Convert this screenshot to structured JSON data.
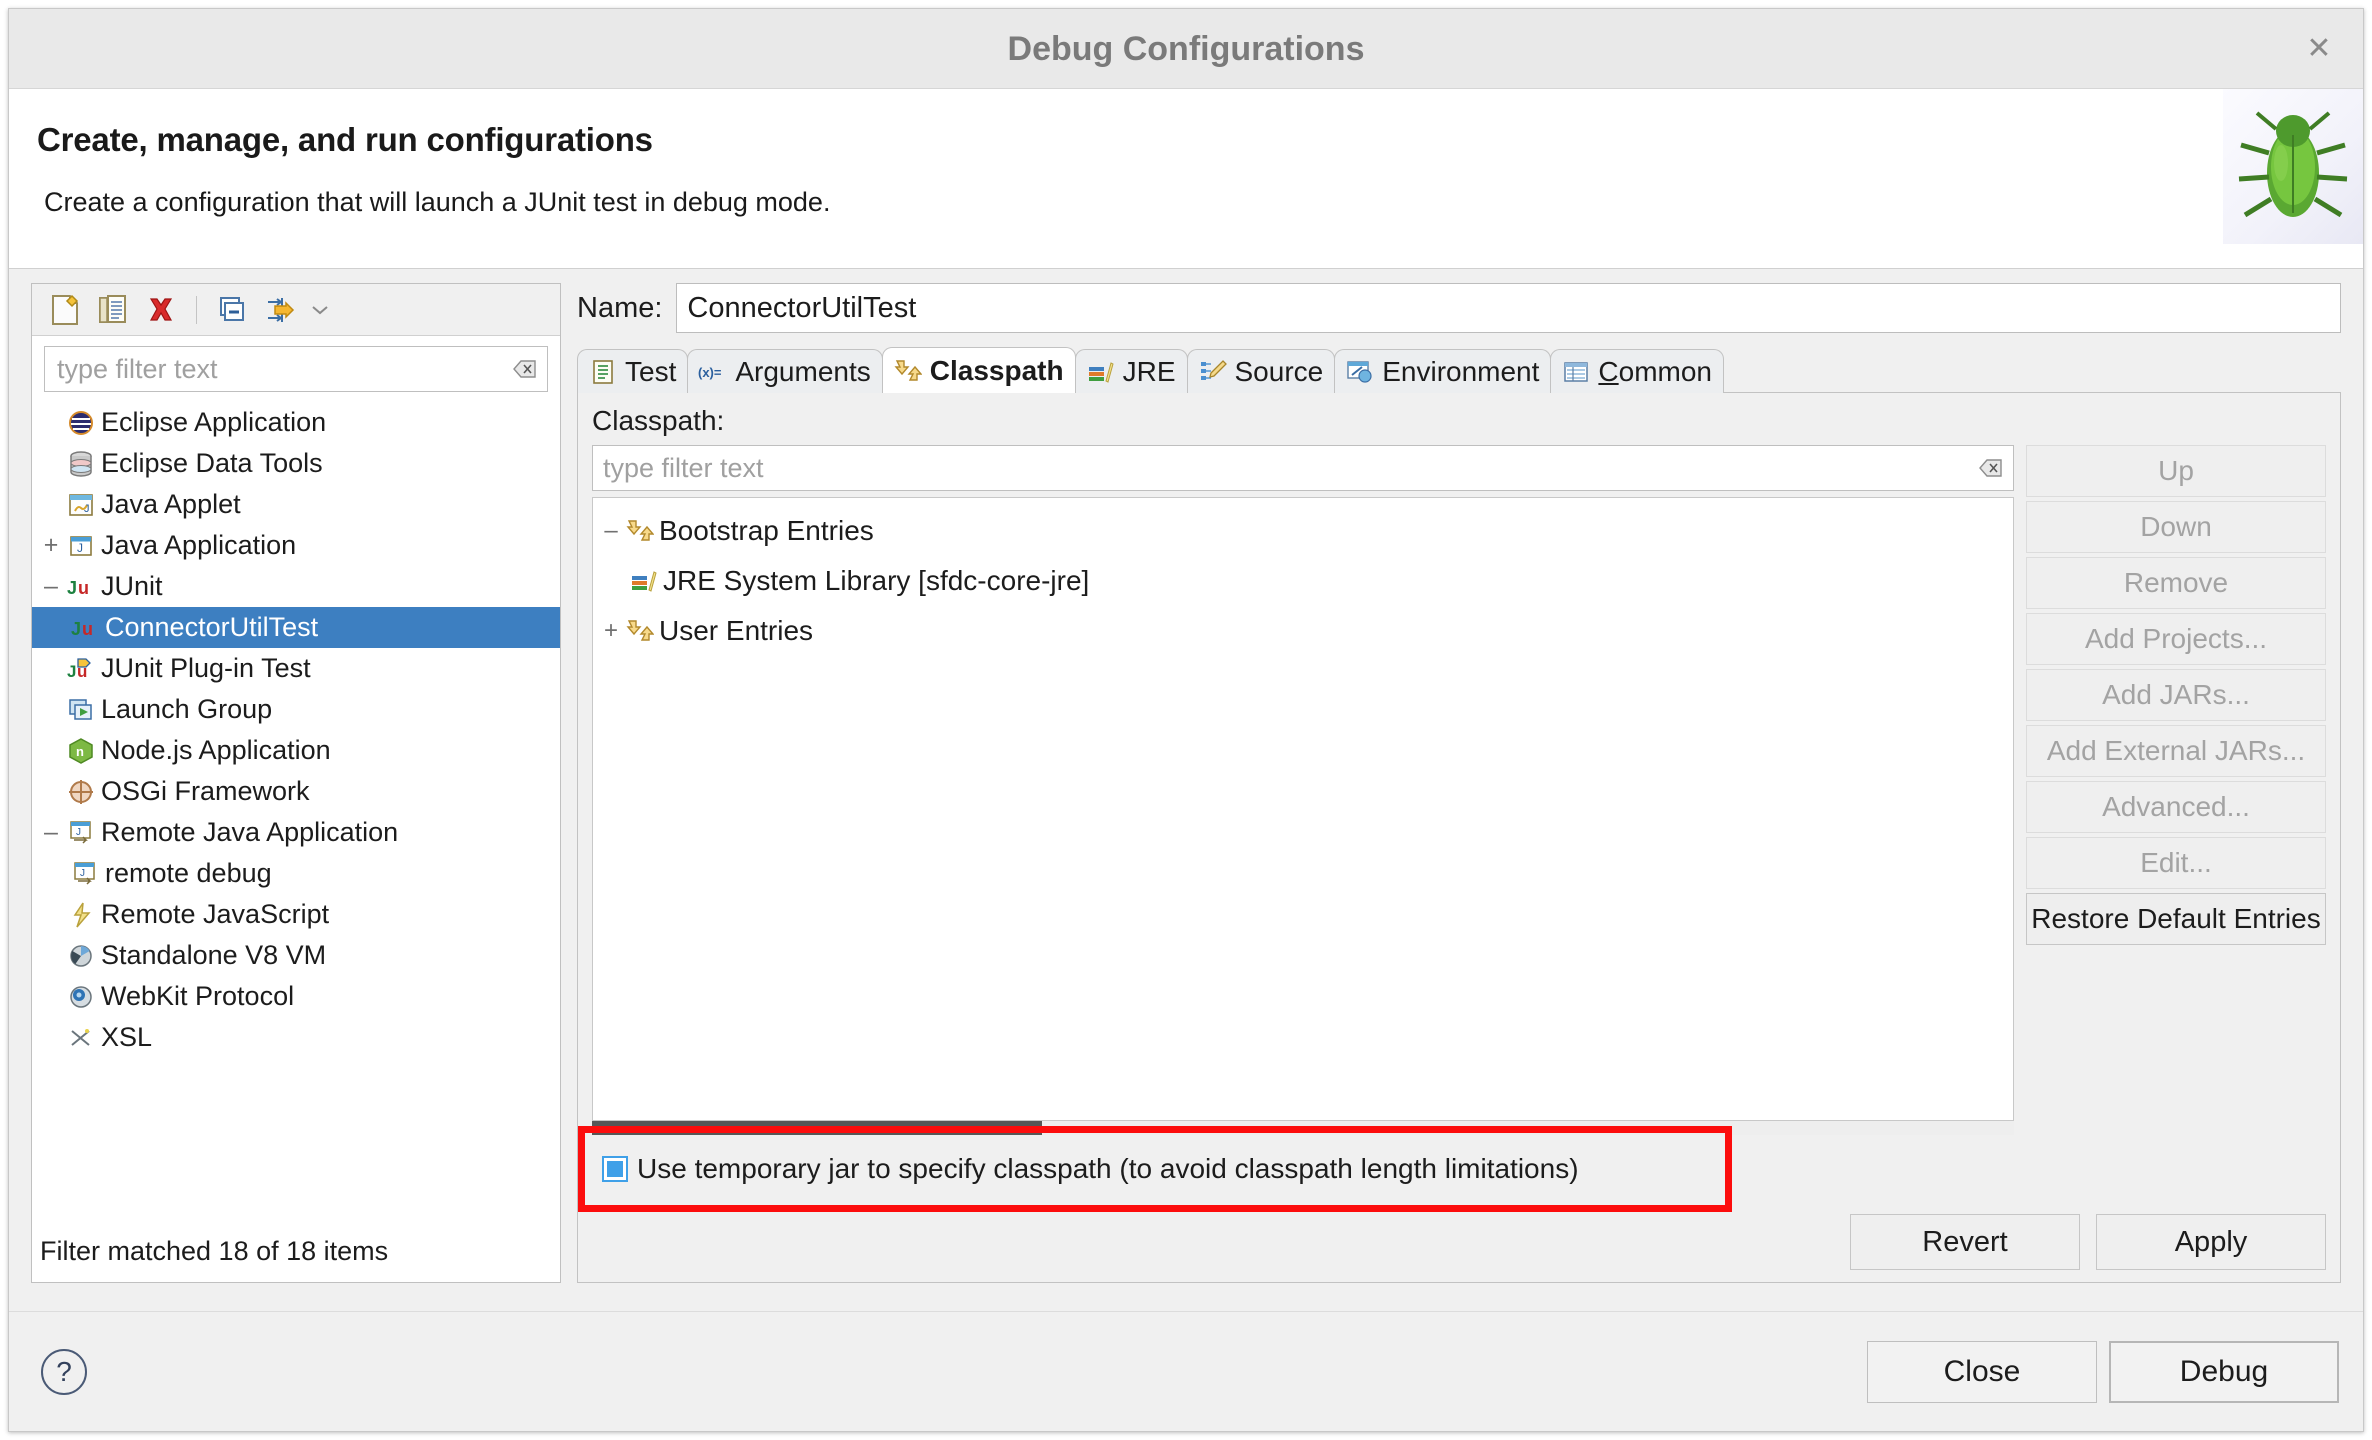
{
  "window": {
    "title": "Debug Configurations",
    "close_label": "✕"
  },
  "header": {
    "title": "Create, manage, and run configurations",
    "subtitle": "Create a configuration that will launch a JUnit test in debug mode.",
    "image": "bug-image"
  },
  "left_panel": {
    "toolbar": [
      {
        "name": "new-configuration-icon",
        "tooltip": "New launch configuration"
      },
      {
        "name": "duplicate-configuration-icon",
        "tooltip": "Duplicate"
      },
      {
        "name": "delete-configuration-icon",
        "tooltip": "Delete"
      },
      {
        "name": "collapse-all-icon",
        "tooltip": "Collapse All"
      },
      {
        "name": "filter-icon",
        "tooltip": "Filter launch configurations"
      },
      {
        "name": "chevron-down-icon",
        "tooltip": "View Menu"
      }
    ],
    "filter": {
      "placeholder": "type filter text",
      "value": ""
    },
    "tree": [
      {
        "label": "Eclipse Application",
        "icon": "eclipse-icon",
        "expander": "",
        "indent": 0,
        "selected": false
      },
      {
        "label": "Eclipse Data Tools",
        "icon": "database-icon",
        "expander": "",
        "indent": 0,
        "selected": false
      },
      {
        "label": "Java Applet",
        "icon": "java-applet-icon",
        "expander": "",
        "indent": 0,
        "selected": false
      },
      {
        "label": "Java Application",
        "icon": "java-application-icon",
        "expander": "+",
        "indent": 0,
        "selected": false
      },
      {
        "label": "JUnit",
        "icon": "junit-icon",
        "expander": "–",
        "indent": 0,
        "selected": false
      },
      {
        "label": "ConnectorUtilTest",
        "icon": "junit-icon",
        "expander": "",
        "indent": 1,
        "selected": true
      },
      {
        "label": "JUnit Plug-in Test",
        "icon": "junit-plugin-icon",
        "expander": "",
        "indent": 0,
        "selected": false
      },
      {
        "label": "Launch Group",
        "icon": "launch-group-icon",
        "expander": "",
        "indent": 0,
        "selected": false
      },
      {
        "label": "Node.js Application",
        "icon": "nodejs-icon",
        "expander": "",
        "indent": 0,
        "selected": false
      },
      {
        "label": "OSGi Framework",
        "icon": "osgi-icon",
        "expander": "",
        "indent": 0,
        "selected": false
      },
      {
        "label": "Remote Java Application",
        "icon": "remote-java-icon",
        "expander": "–",
        "indent": 0,
        "selected": false
      },
      {
        "label": "remote debug",
        "icon": "remote-java-icon",
        "expander": "",
        "indent": 1,
        "selected": false
      },
      {
        "label": "Remote JavaScript",
        "icon": "remote-javascript-icon",
        "expander": "",
        "indent": 0,
        "selected": false
      },
      {
        "label": "Standalone V8 VM",
        "icon": "v8-icon",
        "expander": "",
        "indent": 0,
        "selected": false
      },
      {
        "label": "WebKit Protocol",
        "icon": "webkit-icon",
        "expander": "",
        "indent": 0,
        "selected": false
      },
      {
        "label": "XSL",
        "icon": "xsl-icon",
        "expander": "",
        "indent": 0,
        "selected": false
      }
    ],
    "status": "Filter matched 18 of 18 items"
  },
  "right_panel": {
    "name_label": "Name:",
    "name_value": "ConnectorUtilTest",
    "tabs": [
      {
        "label": "Test",
        "icon": "test-icon",
        "active": false
      },
      {
        "label": "Arguments",
        "icon": "arguments-icon",
        "active": false
      },
      {
        "label": "Classpath",
        "icon": "classpath-icon",
        "active": true
      },
      {
        "label": "JRE",
        "icon": "jre-icon",
        "active": false
      },
      {
        "label": "Source",
        "icon": "source-icon",
        "active": false
      },
      {
        "label": "Environment",
        "icon": "environment-icon",
        "active": false
      },
      {
        "label": "Common",
        "icon": "common-icon",
        "active": false,
        "mnemonic": "C"
      }
    ],
    "classpath": {
      "label": "Classpath:",
      "filter": {
        "placeholder": "type filter text",
        "value": ""
      },
      "tree": [
        {
          "label": "Bootstrap Entries",
          "icon": "classpath-folder-icon",
          "expander": "–",
          "indent": 0
        },
        {
          "label": "JRE System Library [sfdc-core-jre]",
          "icon": "jre-library-icon",
          "expander": "",
          "indent": 1
        },
        {
          "label": "User Entries",
          "icon": "classpath-folder-icon",
          "expander": "+",
          "indent": 0
        }
      ],
      "buttons": [
        {
          "label": "Up",
          "enabled": false
        },
        {
          "label": "Down",
          "enabled": false
        },
        {
          "label": "Remove",
          "enabled": false
        },
        {
          "label": "Add Projects...",
          "enabled": false
        },
        {
          "label": "Add JARs...",
          "enabled": false
        },
        {
          "label": "Add External JARs...",
          "enabled": false
        },
        {
          "label": "Advanced...",
          "enabled": false
        },
        {
          "label": "Edit...",
          "enabled": false
        },
        {
          "label": "Restore Default Entries",
          "enabled": true
        }
      ],
      "checkbox": {
        "label": "Use temporary jar to specify classpath (to avoid classpath length limitations)",
        "checked": true,
        "highlight_color": "#fc0d0d"
      }
    },
    "actions": [
      {
        "label": "Revert"
      },
      {
        "label": "Apply"
      }
    ]
  },
  "footer": {
    "help_icon": "help-icon",
    "help_glyph": "?",
    "buttons": [
      {
        "label": "Close",
        "default": false
      },
      {
        "label": "Debug",
        "default": true
      }
    ]
  },
  "colors": {
    "selection_blue": "#3d7fc1",
    "highlight_red": "#fc0d0d",
    "checkbox_blue": "#3fa0e8"
  }
}
